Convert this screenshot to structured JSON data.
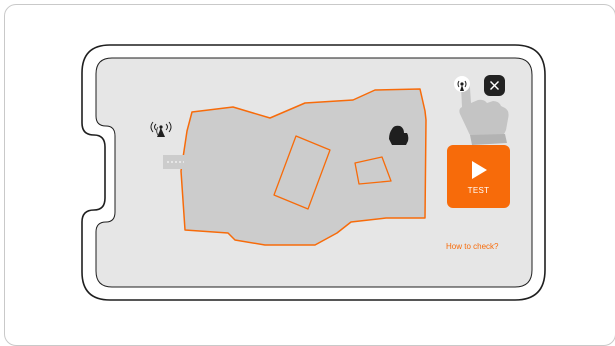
{
  "test_button": {
    "label": "TEST",
    "icon": "play-icon"
  },
  "help_link": {
    "label": "How to check?"
  },
  "close_button": {
    "icon": "close-icon"
  },
  "colors": {
    "accent": "#f76b0a",
    "screen": "#e6e6e6",
    "lawn": "#cccccc",
    "outline": "#1f1f1f"
  },
  "icons": [
    "antenna-icon",
    "signal-icon",
    "hand-press-icon",
    "robot-mower-icon"
  ]
}
